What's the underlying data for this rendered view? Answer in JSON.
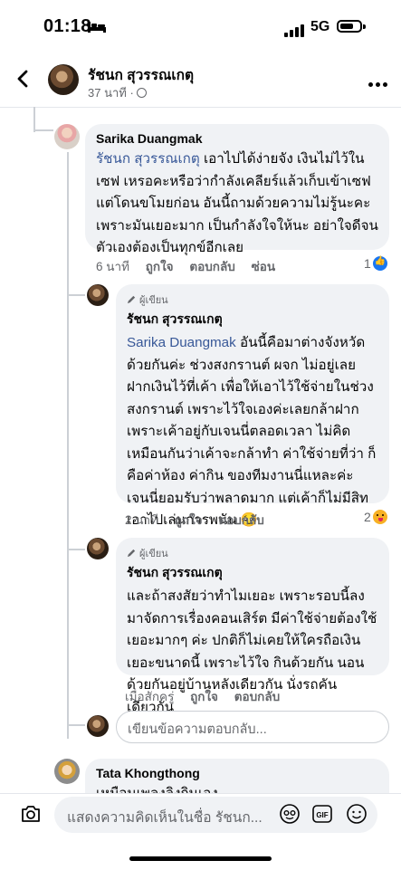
{
  "status_bar": {
    "time": "01:18",
    "network": "5G"
  },
  "header": {
    "name": "รัชนก สุวรรณเกตุ",
    "meta": "37 นาที ·"
  },
  "comments": {
    "sarika": {
      "name": "Sarika Duangmak",
      "mention": "รัชนก สุวรรณเกตุ",
      "text": "เอาไปได้ง่ายจัง เงินไม่ไว้ในเซฟ เหรอคะหรือว่ากำลังเคลียร์แล้วเก็บเข้าเซฟ แต่โดนขโมยก่อน อันนี้ถามด้วยความไม่รู้นะคะ เพราะมันเยอะมาก เป็นกำลังใจให้นะ อย่าใจดีจนตัวเองต้องเป็นทุกข์อีกเลย",
      "time": "6 นาที",
      "like": "ถูกใจ",
      "reply": "ตอบกลับ",
      "hide": "ซ่อน",
      "reaction_count": "1"
    },
    "reply1": {
      "author_tag": "ผู้เขียน",
      "name": "รัชนก สุวรรณเกตุ",
      "mention": "Sarika Duangmak",
      "text": "อันนี้คือมาต่างจังหวัดด้วยกันค่ะ ช่วงสงกรานต์ ผจก ไม่อยู่เลยฝากเงินไว้ที่เค้า เพื่อให้เอาไว้ใช้จ่ายในช่วงสงกรานต์ เพราะไว้ใจเองค่ะเลยกล้าฝาก เพราะเค้าอยู่กับเจนนี่ตลอดเวลา ไม่คิดเหมือนกันว่าเค้าจะกล้าทำ ค่าใช้จ่ายที่ว่า ก็คือค่าห้อง ค่ากิน ของทีมงานนี่แหละค่ะ เจนนี่ยอมรับว่าพลาดมาก แต่เค้าก็ไม่มีสิทเอาไปเล่นการพนัน 🥺",
      "time": "2 นาที",
      "like": "ถูกใจ",
      "reply": "ตอบกลับ",
      "reaction_count": "2"
    },
    "reply2": {
      "author_tag": "ผู้เขียน",
      "name": "รัชนก สุวรรณเกตุ",
      "text": "และถ้าสงสัยว่าทำไมเยอะ เพราะรอบนี้ลงมาจัดการเรื่องคอนเสิร์ต มีค่าใช้จ่ายต้องใช้เยอะมากๆ ค่ะ ปกติก็ไม่เคยให้ใครถือเงินเยอะขนาดนี้ เพราะไว้ใจ กินด้วยกัน นอนด้วยกันอยู่บ้านหลังเดียวกัน นั่งรถคันเดียวกัน",
      "time": "เมื่อสักครู่",
      "like": "ถูกใจ",
      "reply": "ตอบกลับ"
    },
    "reply_box": {
      "placeholder": "เขียนข้อความตอบกลับ..."
    },
    "tata": {
      "name": "Tata Khongthong",
      "text": "เหมือนเพลงลิงกินเอง..."
    }
  },
  "composer": {
    "placeholder": "แสดงความคิดเห็นในชื่อ รัชนก..."
  },
  "icons": [
    "back-icon",
    "globe-icon",
    "more-icon",
    "pencil-icon",
    "like-reaction-icon",
    "emoji-reaction-icon",
    "camera-icon",
    "sticker-icon",
    "gif-icon",
    "smiley-icon"
  ]
}
